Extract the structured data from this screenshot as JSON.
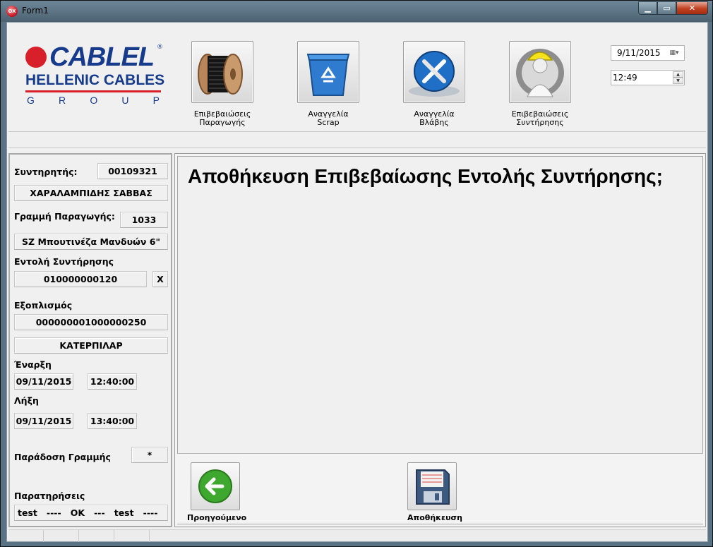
{
  "window": {
    "title": "Form1",
    "app_icon_text": "OX"
  },
  "logo": {
    "line1": "CABLEL",
    "reg": "®",
    "line2": "HELLENIC CABLES",
    "line3": [
      "G",
      "R",
      "O",
      "U",
      "P"
    ]
  },
  "toolbar": {
    "production": [
      "Επιβεβαιώσεις",
      "Παραγωγής"
    ],
    "scrap": [
      "Αναγγελία",
      "Scrap"
    ],
    "breakdown": [
      "Αναγγελία",
      "Βλάβης"
    ],
    "maintenance": [
      "Επιβεβαιώσεις",
      "Συντήρησης"
    ]
  },
  "date_picker": {
    "value": "9/11/2015"
  },
  "time_picker": {
    "value": "12:49"
  },
  "left": {
    "technician_label": "Συντηρητής:",
    "technician_code": "00109321",
    "technician_name": "ΧΑΡΑΛΑΜΠΙΔΗΣ ΣΑΒΒΑΣ",
    "line_label": "Γραμμή Παραγωγής:",
    "line_code": "1033",
    "line_name": "SZ Μπουτινέζα Μανδυών 6\"",
    "order_label": "Εντολή Συντήρησης",
    "order_value": "010000000120",
    "order_clear": "X",
    "equipment_label": "Εξοπλισμός",
    "equipment_code": "000000001000000250",
    "equipment_name": "ΚΑΤΕΡΠΙΛΑΡ",
    "start_label": "Έναρξη",
    "start_date": "09/11/2015",
    "start_time": "12:40:00",
    "end_label": "Λήξη",
    "end_date": "09/11/2015",
    "end_time": "13:40:00",
    "handover_label": "Παράδοση Γραμμής",
    "handover_value": "*",
    "notes_label": "Παρατηρήσεις",
    "notes_value": "test   ----   OK   ---   test   ----"
  },
  "main": {
    "prompt": "Αποθήκευση Επιβεβαίωσης Εντολής Συντήρησης;",
    "back_label": "Προηγούμενο",
    "save_label": "Αποθήκευση"
  },
  "colors": {
    "brand_blue": "#173b8c",
    "brand_red": "#d8202a",
    "back_green": "#3ea82e",
    "save_blue": "#3d5a7e"
  }
}
